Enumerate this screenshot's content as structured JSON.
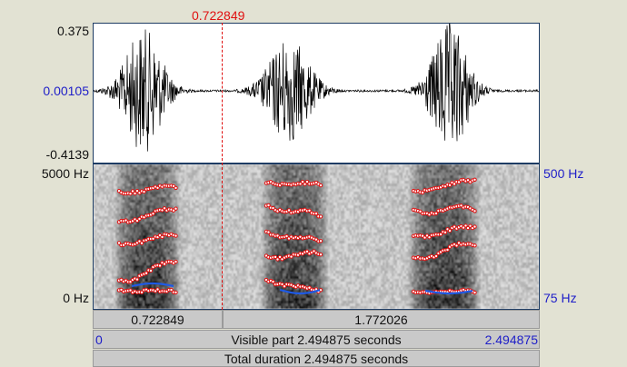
{
  "cursor": {
    "time_label": "0.722849",
    "time_fraction": 0.2897
  },
  "waveform": {
    "y_max_label": "0.375",
    "y_zero_label": "0.00105",
    "y_min_label": "-0.4139"
  },
  "spectrogram": {
    "freq_max_label": "5000 Hz",
    "freq_min_label": "0 Hz",
    "pitch_max_label": "500 Hz",
    "pitch_min_label": "75 Hz"
  },
  "selection_bar": {
    "left_duration": "0.722849",
    "right_duration": "1.772026"
  },
  "visible_bar": {
    "start": "0",
    "label": "Visible part 2.494875 seconds",
    "end": "2.494875"
  },
  "total_bar": {
    "label": "Total duration 2.494875 seconds"
  },
  "colors": {
    "cursor": "#e01010",
    "pitch": "#1e5ae6",
    "formant": "#e01010",
    "value_blue": "#1e1ec8"
  }
}
